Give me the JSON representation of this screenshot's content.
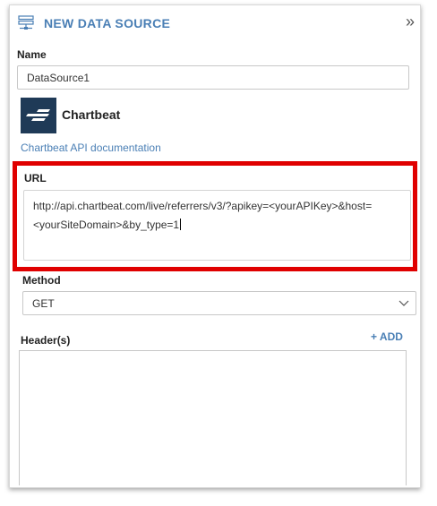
{
  "header": {
    "title": "NEW DATA SOURCE",
    "collapse_glyph": "»",
    "icon": "data-source-icon"
  },
  "name_field": {
    "label": "Name",
    "value": "DataSource1"
  },
  "provider": {
    "name": "Chartbeat",
    "logo_icon": "chartbeat-logo",
    "logo_color": "#1f3a57",
    "doc_link": "Chartbeat API documentation"
  },
  "url_field": {
    "label": "URL",
    "line1": "http://api.chartbeat.com/live/referrers/v3/?apikey=<yourAPIKey>&host=",
    "line2": "<yourSiteDomain>&by_type=1",
    "highlight_color": "#e00000"
  },
  "method_field": {
    "label": "Method",
    "selected": "GET"
  },
  "headers_field": {
    "label": "Header(s)",
    "add_label": "ADD",
    "add_glyph": "+"
  },
  "accent_color": "#4a7fb5"
}
